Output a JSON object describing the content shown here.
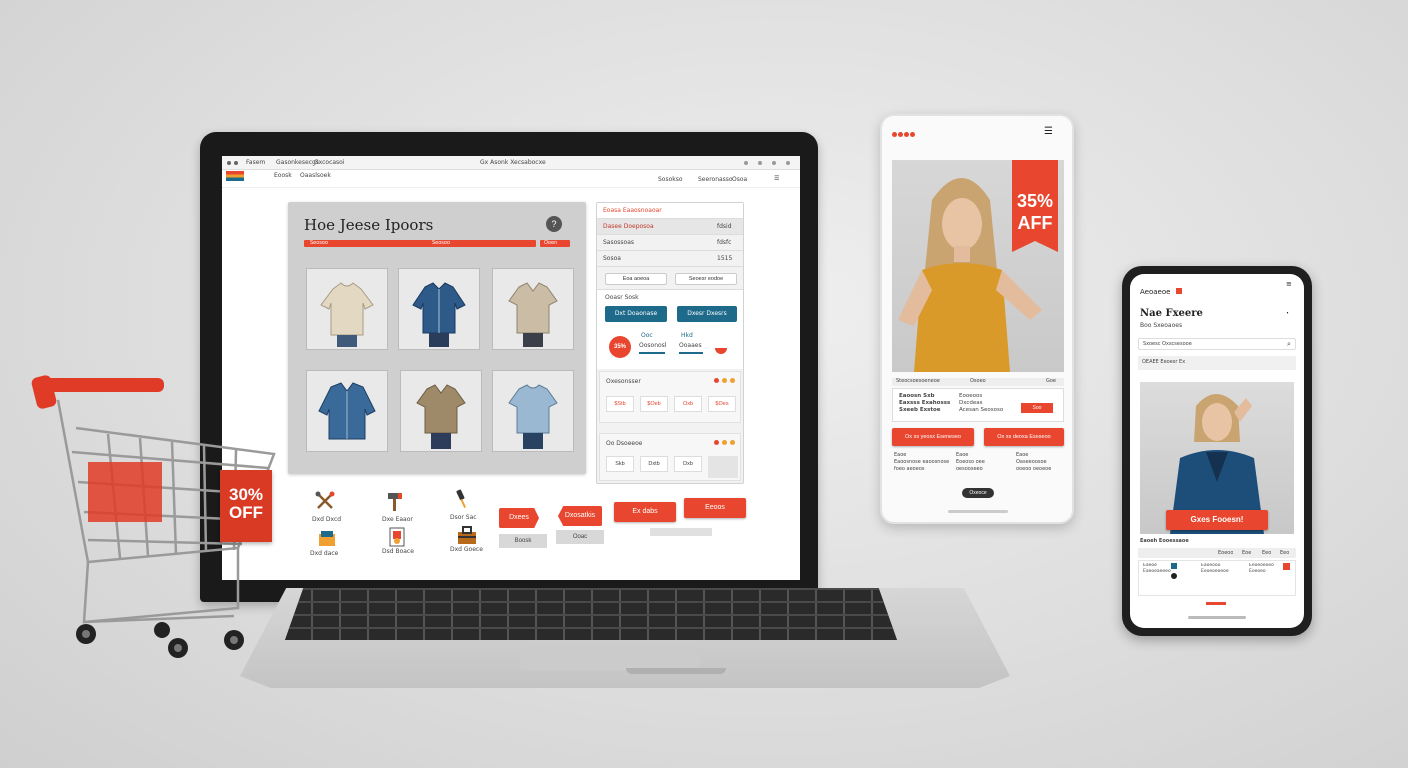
{
  "colors": {
    "accent": "#e8462e",
    "blue": "#1d6a8a",
    "dark": "#1a1a1a"
  },
  "laptop": {
    "browser": {
      "tab_a": "Fasem",
      "tab_b": "Gasonkesecgs",
      "tab_c": "Gxcocasoi",
      "address": "Gx Asonk Xecsabocxe"
    },
    "nav": {
      "link_1": "Eoosk",
      "link_2": "Oaaslsoek",
      "right_1": "Sosokso",
      "right_2": "Seeronasso",
      "right_3": "Osoa"
    },
    "panel": {
      "title": "Hoe Jeese Ipoors",
      "bar_left": "Seosoo",
      "bar_mid": "Seosoo",
      "bar_right": "Ooen"
    },
    "products": [
      "beige-hoodie",
      "denim-shirt",
      "tan-polo",
      "denim-jacket",
      "olive-polo",
      "blue-tee"
    ],
    "side": {
      "header": "Eoasa Eaaosnoaoar",
      "row1": "Dasee Doeposoa",
      "row1_right": "fdsid",
      "row2": "Sasossoas",
      "row2_right": "fdsfc",
      "row3": "Sosoa",
      "row3_right": "1515",
      "btn_a": "Eoa aoeoa",
      "btn_b": "Seoesr eodoe",
      "section": "Ooasr Sosk",
      "blue_a": "Dxt Doaonase",
      "blue_b": "Dxesr Dxesrs",
      "badge": "35%",
      "price_a": "Ooc",
      "price_b": "Hkd",
      "sub_a": "Oosonosl",
      "sub_b": "Ooaaes",
      "list_title": "Oxesonsser",
      "chips": [
        "$Stb",
        "$Oeb",
        "Oxb",
        "$Oes"
      ],
      "list2_title": "Oo Dsoeeoe",
      "chips2": [
        "Skb",
        "Dxtb",
        "Dxb"
      ]
    },
    "icons": [
      {
        "name": "crossed-tools-icon",
        "label": "Dxd Dxcd"
      },
      {
        "name": "hammer-icon",
        "label": "Dxe Eaaor"
      },
      {
        "name": "screwdriver-icon",
        "label": "Dsor Sac"
      },
      {
        "name": "folder-icon",
        "label": "Dxd dace"
      },
      {
        "name": "medal-icon",
        "label": "Dsd Boace"
      },
      {
        "name": "toolbox-icon",
        "label": "Dxd Goece"
      }
    ],
    "buttons": {
      "r1": "Dxees",
      "r2": "Dxosatkis",
      "r3": "Ex dabs",
      "r4": "Eeoos",
      "g1": "Boosk",
      "g2": "Ooac"
    }
  },
  "cart": {
    "sign": "30%\nOFF"
  },
  "tablet": {
    "badge": "35%\nAFF",
    "strip": {
      "a": "Steocsoesoeneoe",
      "b": "Osoeo",
      "c": "Goe"
    },
    "info_title": "Eaoosn Sxb\nEaxsss Exahosss\nSxeeb Exstoe",
    "info_mid": "Eooeoos\nDxcdeas\nAcesan Seososo",
    "info_right": "Soo",
    "btn_a": "Ox xs yeosx Eseneseo",
    "btn_b": "Ox xs deoxa Eseseoo",
    "notes": [
      "Eaoe\nEaoosnose eaoosnose\nfoeo aeoeos",
      "Eaoe\nEoeoso oee\noesooseeo",
      "Eaoe\nOaseeoosoe\nooeoo oeoeoe"
    ],
    "pill": "Oxeoce"
  },
  "phone": {
    "brand": "Aeoaeoe",
    "title": "Nae Fxeere",
    "subtitle": "Boo Sxeoaoes",
    "search": "Sxoesc Oxscsesooe",
    "filter": "OEAEE Eeoesr Ex",
    "cta": "Gxes Fooesn!",
    "table_title": "Eaoeh Eooessaoe",
    "cols": [
      "Eoeoo",
      "Eoe",
      "Eeo",
      "Eeo"
    ],
    "rows": [
      "Eaeoe\nEaeoeaeeeo",
      "Eaoeooo\nEeoeoeoeoe",
      "Eeoeoeoeo\nEoeoeo"
    ]
  }
}
